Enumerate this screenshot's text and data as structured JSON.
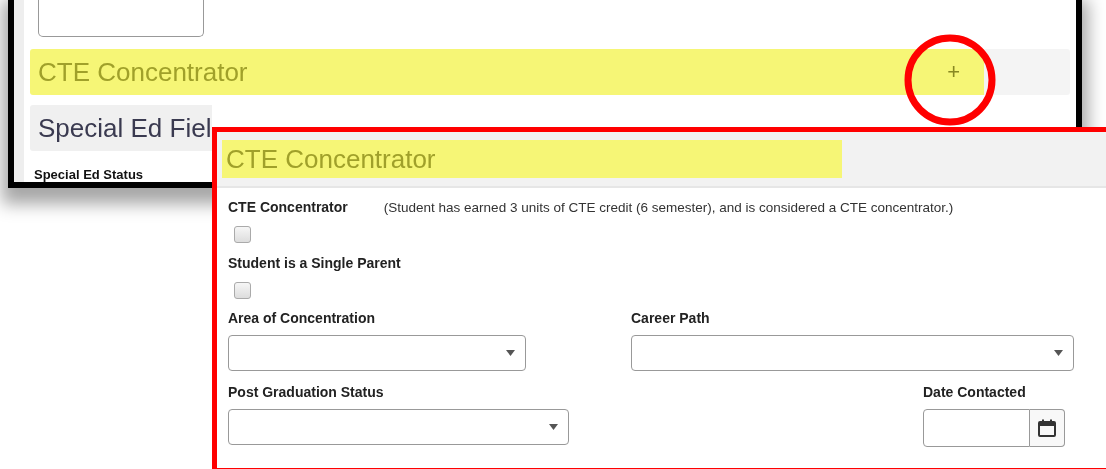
{
  "background_form": {
    "sections": [
      {
        "title": "CTE Concentrator",
        "highlighted": true,
        "toggle": "+"
      },
      {
        "title": "Special Ed Fiel",
        "highlighted": false
      }
    ],
    "field_label": "Special Ed Status"
  },
  "callout": {
    "title": "CTE Concentrator",
    "highlighted": true,
    "checkboxes": [
      {
        "label": "CTE Concentrator",
        "note": "(Student has earned 3 units of CTE credit (6 semester), and is considered a CTE concentrator.)",
        "checked": false
      },
      {
        "label": "Student is a Single Parent",
        "checked": false
      }
    ],
    "rows": [
      [
        {
          "kind": "select",
          "label": "Area of Concentration"
        },
        {
          "kind": "select",
          "label": "Career Path"
        }
      ],
      [
        {
          "kind": "select",
          "label": "Post Graduation Status"
        },
        {
          "kind": "date",
          "label": "Date Contacted"
        }
      ]
    ]
  }
}
